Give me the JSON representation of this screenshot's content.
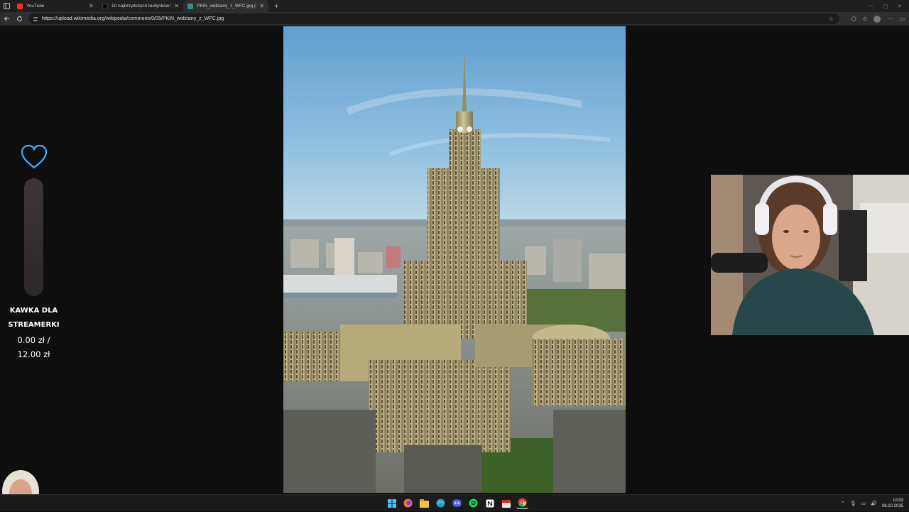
{
  "browser": {
    "tabs": [
      {
        "title": "YouTube",
        "favicon_color": "#ff2d2d",
        "active": false
      },
      {
        "title": "10 najbrzydszych budynków w Po",
        "favicon_color": "#0b0b0b",
        "active": false
      },
      {
        "title": "PKiN_widziany_z_WFC.jpg (2026",
        "favicon_color": "#3d8a8a",
        "active": true
      }
    ],
    "url": "https://upload.wikimedia.org/wikipedia/commons/0/05/PKiN_widziany_z_WFC.jpg"
  },
  "overlay": {
    "donate_title_line1": "KAWKA DLA",
    "donate_title_line2": "STREAMERKI",
    "donate_current": "0.00 zł /",
    "donate_goal": "12.00 zł",
    "donate_progress": 0.0,
    "accent_color": "#3fb0ff"
  },
  "taskbar": {
    "apps": [
      "windows-start",
      "firefox",
      "file-explorer",
      "edge",
      "discord",
      "spotify",
      "notion",
      "calendar",
      "chrome"
    ],
    "time": "10:03",
    "date": "08.10.2025"
  }
}
